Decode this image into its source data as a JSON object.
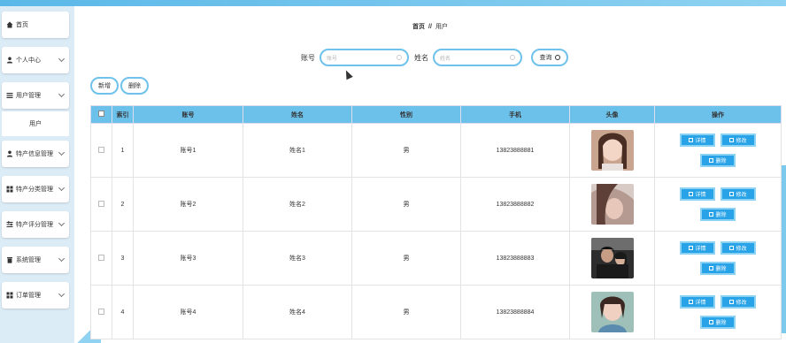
{
  "sidebar": {
    "items": [
      {
        "label": "首页",
        "icon": "home-icon",
        "has_chevron": false
      },
      {
        "label": "个人中心",
        "icon": "user-icon",
        "has_chevron": true
      },
      {
        "label": "用户管理",
        "icon": "list-icon",
        "has_chevron": true
      },
      {
        "label": "特产信息管理",
        "icon": "user-icon",
        "has_chevron": true
      },
      {
        "label": "特产分类管理",
        "icon": "grid-icon",
        "has_chevron": true
      },
      {
        "label": "特产评分管理",
        "icon": "sliders-icon",
        "has_chevron": true
      },
      {
        "label": "系统管理",
        "icon": "trash-icon",
        "has_chevron": true
      },
      {
        "label": "订单管理",
        "icon": "grid-icon",
        "has_chevron": true
      }
    ],
    "sub_item": "用户"
  },
  "breadcrumb": {
    "home": "首页",
    "separator": "//",
    "current": "用户"
  },
  "search": {
    "account_label": "账号",
    "account_placeholder": "账号",
    "name_label": "姓名",
    "name_placeholder": "姓名",
    "query_label": "查询"
  },
  "actions": {
    "add": "新增",
    "delete": "删除"
  },
  "table": {
    "headers": [
      "",
      "索引",
      "账号",
      "姓名",
      "性别",
      "手机",
      "头像",
      "操作"
    ],
    "rows": [
      {
        "index": "1",
        "account": "账号1",
        "name": "姓名1",
        "gender": "男",
        "phone": "13823888881"
      },
      {
        "index": "2",
        "account": "账号2",
        "name": "姓名2",
        "gender": "男",
        "phone": "13823888882"
      },
      {
        "index": "3",
        "account": "账号3",
        "name": "姓名3",
        "gender": "男",
        "phone": "13823888883"
      },
      {
        "index": "4",
        "account": "账号4",
        "name": "姓名4",
        "gender": "男",
        "phone": "13823888884"
      }
    ],
    "row_actions": {
      "detail": "详情",
      "edit": "修改",
      "delete": "删除"
    }
  },
  "colors": {
    "accent": "#6cc1ea",
    "button_blue": "#29a3e8",
    "topbar": "#5ab8e8"
  }
}
